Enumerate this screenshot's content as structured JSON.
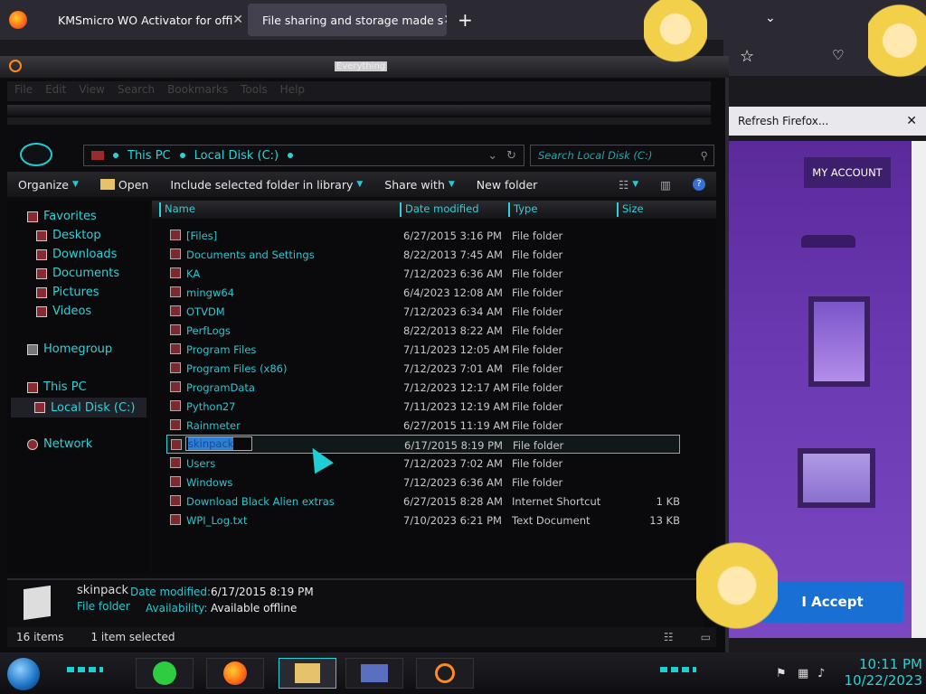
{
  "browser": {
    "tabs": [
      {
        "label": "KMSmicro WO Activator for offi"
      },
      {
        "label": "File sharing and storage made s"
      }
    ],
    "new_tab": "+",
    "notification": "Refresh Firefox..."
  },
  "webpage": {
    "my_account": "MY ACCOUNT",
    "accept": "I Accept"
  },
  "explorer": {
    "title_overlay": "Everything",
    "menu": [
      "File",
      "Edit",
      "View",
      "Search",
      "Bookmarks",
      "Tools",
      "Help"
    ],
    "address": {
      "part1": "This PC",
      "part2": "Local Disk (C:)"
    },
    "search_placeholder": "Search Local Disk (C:)",
    "commands": [
      "Organize",
      "Open",
      "Include selected folder in library",
      "Share with",
      "New folder"
    ],
    "nav": {
      "favorites": "Favorites",
      "fav_items": [
        "Desktop",
        "Downloads",
        "Documents",
        "Pictures",
        "Videos"
      ],
      "homegroup": "Homegroup",
      "this_pc": "This PC",
      "local_disk": "Local Disk (C:)",
      "network": "Network"
    },
    "columns": {
      "name": "Name",
      "date": "Date modified",
      "type": "Type",
      "size": "Size"
    },
    "files": [
      {
        "name": "[Files]",
        "date": "6/27/2015 3:16 PM",
        "type": "File folder",
        "size": ""
      },
      {
        "name": "Documents and Settings",
        "date": "8/22/2013 7:45 AM",
        "type": "File folder",
        "size": ""
      },
      {
        "name": "KA",
        "date": "7/12/2023 6:36 AM",
        "type": "File folder",
        "size": ""
      },
      {
        "name": "mingw64",
        "date": "6/4/2023 12:08 AM",
        "type": "File folder",
        "size": ""
      },
      {
        "name": "OTVDM",
        "date": "7/12/2023 6:34 AM",
        "type": "File folder",
        "size": ""
      },
      {
        "name": "PerfLogs",
        "date": "8/22/2013 8:22 AM",
        "type": "File folder",
        "size": ""
      },
      {
        "name": "Program Files",
        "date": "7/11/2023 12:05 AM",
        "type": "File folder",
        "size": ""
      },
      {
        "name": "Program Files (x86)",
        "date": "7/12/2023 7:01 AM",
        "type": "File folder",
        "size": ""
      },
      {
        "name": "ProgramData",
        "date": "7/12/2023 12:17 AM",
        "type": "File folder",
        "size": ""
      },
      {
        "name": "Python27",
        "date": "7/11/2023 12:19 AM",
        "type": "File folder",
        "size": ""
      },
      {
        "name": "Rainmeter",
        "date": "6/27/2015 11:19 AM",
        "type": "File folder",
        "size": ""
      },
      {
        "name": "skinpack",
        "date": "6/17/2015 8:19 PM",
        "type": "File folder",
        "size": ""
      },
      {
        "name": "Users",
        "date": "7/12/2023 7:02 AM",
        "type": "File folder",
        "size": ""
      },
      {
        "name": "Windows",
        "date": "7/12/2023 6:36 AM",
        "type": "File folder",
        "size": ""
      },
      {
        "name": "Download Black Alien extras",
        "date": "6/27/2015 8:28 AM",
        "type": "Internet Shortcut",
        "size": "1 KB"
      },
      {
        "name": "WPI_Log.txt",
        "date": "7/10/2023 6:21 PM",
        "type": "Text Document",
        "size": "13 KB"
      }
    ],
    "details": {
      "name": "skinpack",
      "type": "File folder",
      "date_label": "Date modified:",
      "date_value": "6/17/2015 8:19 PM",
      "avail_label": "Availability:",
      "avail_value": "Available offline"
    },
    "status": {
      "count": "16 items",
      "selected": "1 item selected"
    }
  },
  "taskbar": {
    "time": "10:11 PM",
    "date": "10/22/2023"
  }
}
